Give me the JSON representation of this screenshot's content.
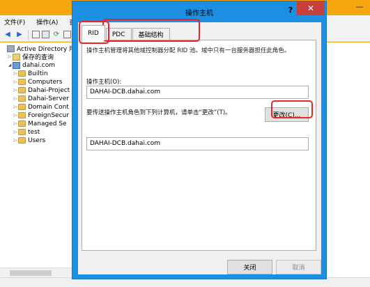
{
  "background_window": {
    "menu": [
      "文件(F)",
      "操作(A)",
      "查看"
    ],
    "tree": [
      {
        "label": "Active Directory 用户",
        "kind": "ad",
        "indent": 0,
        "arrow": ""
      },
      {
        "label": "保存的查询",
        "kind": "saved",
        "indent": 1,
        "arrow": "▷"
      },
      {
        "label": "dahai.com",
        "kind": "domain",
        "indent": 1,
        "arrow": "◢"
      },
      {
        "label": "Builtin",
        "kind": "folder",
        "indent": 2,
        "arrow": "▷"
      },
      {
        "label": "Computers",
        "kind": "folder",
        "indent": 2,
        "arrow": "▷"
      },
      {
        "label": "Dahai-Project",
        "kind": "folder",
        "indent": 2,
        "arrow": "▷"
      },
      {
        "label": "Dahai-Server",
        "kind": "folder",
        "indent": 2,
        "arrow": "▷"
      },
      {
        "label": "Domain Cont",
        "kind": "folder",
        "indent": 2,
        "arrow": "▷"
      },
      {
        "label": "ForeignSecur",
        "kind": "folder",
        "indent": 2,
        "arrow": "▷"
      },
      {
        "label": "Managed Se",
        "kind": "folder",
        "indent": 2,
        "arrow": "▷"
      },
      {
        "label": "test",
        "kind": "folder",
        "indent": 2,
        "arrow": "▷"
      },
      {
        "label": "Users",
        "kind": "folder",
        "indent": 2,
        "arrow": "▷"
      }
    ],
    "title_controls": {
      "minimize": "—"
    }
  },
  "dialog": {
    "title": "操作主机",
    "help": "?",
    "close": "✕",
    "tabs": [
      {
        "label": "RID",
        "active": true
      },
      {
        "label": "PDC",
        "active": false
      },
      {
        "label": "基础结构",
        "active": false
      }
    ],
    "description": "操作主机管理将其他域控制器分配 RID 池。域中只有一台服务器担任此角色。",
    "operations_master_label": "操作主机(O):",
    "operations_master_value": "DAHAI-DCB.dahai.com",
    "transfer_text": "要传送操作主机角色到下列计算机，请单击“更改”(T)。",
    "change_button": "更改(C)...",
    "target_value": "DAHAI-DCB.dahai.com",
    "close_button": "关闭",
    "cancel_button": "取消"
  },
  "colors": {
    "dialog_frame": "#1c8fe3",
    "background_window_frame": "#f6a70d",
    "annotation": "#e8262a",
    "close_button": "#c7413c"
  }
}
